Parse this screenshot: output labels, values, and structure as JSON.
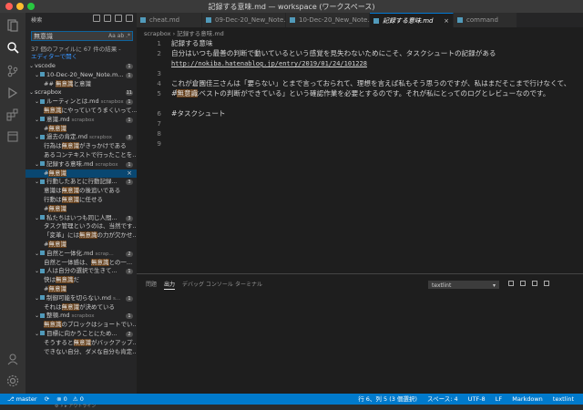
{
  "window": {
    "title": "記録する意味.md — workspace (ワークスペース)"
  },
  "sidebar": {
    "header": "検索",
    "search_value": "無意識",
    "search_options": "Aa ab .*",
    "summary_line1": "37 個のファイルに 67 件の結果 -",
    "summary_link": "エディターで開く",
    "tree": [
      {
        "type": "folder",
        "indent": 0,
        "label": "vscode",
        "count": "1"
      },
      {
        "type": "file",
        "indent": 1,
        "label": "10-Dec-20_New_Note.m...",
        "count": "1"
      },
      {
        "type": "match",
        "indent": 2,
        "pre": "## ",
        "match": "無意識",
        "post": "と意識"
      },
      {
        "type": "folder",
        "indent": 0,
        "label": "scrapbox",
        "count": "11"
      },
      {
        "type": "file",
        "indent": 1,
        "label": "ルーティンとは.md",
        "path": "scrapbox",
        "count": "1"
      },
      {
        "type": "match",
        "indent": 2,
        "pre": "",
        "match": "無意識",
        "post": "にやっていてうまくいって..."
      },
      {
        "type": "file",
        "indent": 1,
        "label": "意識.md",
        "path": "scrapbox",
        "count": "1"
      },
      {
        "type": "match",
        "indent": 2,
        "pre": "#",
        "match": "無意識",
        "post": ""
      },
      {
        "type": "file",
        "indent": 1,
        "label": "過去の肯定.md",
        "path": "scrapbox",
        "count": "3"
      },
      {
        "type": "match",
        "indent": 2,
        "pre": "行為は",
        "match": "無意識",
        "post": "がきっかけである"
      },
      {
        "type": "match",
        "indent": 2,
        "pre": "あるコンテキストで行ったことを...",
        "match": "",
        "post": ""
      },
      {
        "type": "file",
        "indent": 1,
        "label": "記録する意味.md",
        "path": "scrapbox",
        "count": "1"
      },
      {
        "type": "match",
        "indent": 2,
        "pre": "#",
        "match": "無意識",
        "post": "",
        "selected": true
      },
      {
        "type": "file",
        "indent": 1,
        "label": "行動したあとに行動記録...",
        "path": "",
        "count": "3"
      },
      {
        "type": "match",
        "indent": 2,
        "pre": "意識は",
        "match": "無意識",
        "post": "の後追いである"
      },
      {
        "type": "match",
        "indent": 2,
        "pre": "行動は",
        "match": "無意識",
        "post": "に任せる"
      },
      {
        "type": "match",
        "indent": 2,
        "pre": "#",
        "match": "無意識",
        "post": ""
      },
      {
        "type": "file",
        "indent": 1,
        "label": "私たちはいつも同じ人間...",
        "path": "",
        "count": "3"
      },
      {
        "type": "match",
        "indent": 2,
        "pre": "タスク管理というのは、当然です...",
        "match": "",
        "post": ""
      },
      {
        "type": "match",
        "indent": 2,
        "pre": "「変革」には",
        "match": "無意識",
        "post": "の力が欠かせ..."
      },
      {
        "type": "match",
        "indent": 2,
        "pre": "#",
        "match": "無意識",
        "post": ""
      },
      {
        "type": "file",
        "indent": 1,
        "label": "自然と一体化.md",
        "path": "scrap...",
        "count": "2"
      },
      {
        "type": "match",
        "indent": 2,
        "pre": "自然と一体感は、",
        "match": "無意識",
        "post": "との一..."
      },
      {
        "type": "file",
        "indent": 1,
        "label": "人は自分の選択で生きて...",
        "path": "",
        "count": "1"
      },
      {
        "type": "match",
        "indent": 2,
        "pre": "快は",
        "match": "無意識",
        "post": "だ"
      },
      {
        "type": "match",
        "indent": 2,
        "pre": "#",
        "match": "無意識",
        "post": ""
      },
      {
        "type": "file",
        "indent": 1,
        "label": "制御可能を切らない.md",
        "path": "s...",
        "count": "1"
      },
      {
        "type": "match",
        "indent": 2,
        "pre": "それは",
        "match": "無意識",
        "post": "が決めている"
      },
      {
        "type": "file",
        "indent": 1,
        "label": "整頓.md",
        "path": "scrapbox",
        "count": "1"
      },
      {
        "type": "match",
        "indent": 2,
        "pre": "",
        "match": "無意識",
        "post": "のブロックはショートでい..."
      },
      {
        "type": "file",
        "indent": 1,
        "label": "目標に向かうことにため...",
        "path": "",
        "count": "2"
      },
      {
        "type": "match",
        "indent": 2,
        "pre": "そうすると",
        "match": "無意識",
        "post": "がバックアップ..."
      },
      {
        "type": "match",
        "indent": 2,
        "pre": "できない自分、ダメな自分も肯定...",
        "match": "",
        "post": ""
      }
    ]
  },
  "tabs": [
    {
      "label": "cheat.md",
      "active": false
    },
    {
      "label": "09-Dec-20_New_Note.md",
      "active": false
    },
    {
      "label": "10-Dec-20_New_Note.md",
      "active": false
    },
    {
      "label": "記録する意味.md",
      "active": true
    },
    {
      "label": "command",
      "active": false
    }
  ],
  "breadcrumb": {
    "folder": "scrapbox",
    "sep": "›",
    "file": "記録する意味.md"
  },
  "editor": {
    "lines": [
      {
        "n": "1",
        "text": "記録する意味"
      },
      {
        "n": "2",
        "text": "自分はいつも最善の判断で動いているという感覚を見失わないためにこそ、タスクシュートの記録がある"
      },
      {
        "n": "",
        "text": "http://nokiba.hatenablog.jp/entry/2019/01/24/101228",
        "url": true
      },
      {
        "n": "3",
        "text": ""
      },
      {
        "n": "4",
        "text": "これが倉園佳三さんは「要らない」とまで言っておられて、理想を言えば私もそう思うのですが、私はまだそこまで行けなくて、「自分はベストの判断ができている」という確認作業を必要とするのです。それが私にとってのログとレビューなのです。"
      },
      {
        "n": "5",
        "pre": "#",
        "match": "無意識",
        "text": ""
      },
      {
        "n": "6",
        "text": "#タスクシュート"
      },
      {
        "n": "7",
        "text": ""
      },
      {
        "n": "8",
        "text": ""
      },
      {
        "n": "9",
        "text": ""
      }
    ]
  },
  "panel": {
    "tabs": [
      "問題",
      "出力",
      "デバッグ コンソール",
      "ターミナル"
    ],
    "active_tab": "出力",
    "output_select": "textlint"
  },
  "statusbar": {
    "branch": "master",
    "sync": "⟳",
    "errors": "⊗ 0",
    "warnings": "⚠ 0",
    "position": "行 6、列 5 (3 個選択)",
    "spaces": "スペース: 4",
    "encoding": "UTF-8",
    "eol": "LF",
    "language": "Markdown",
    "linter": "textlint"
  },
  "bottom_strip": "⚙ ⚡ ▸ アウトライン",
  "colors": {
    "accent": "#007acc",
    "match": "#613a14",
    "selected": "#094771"
  }
}
